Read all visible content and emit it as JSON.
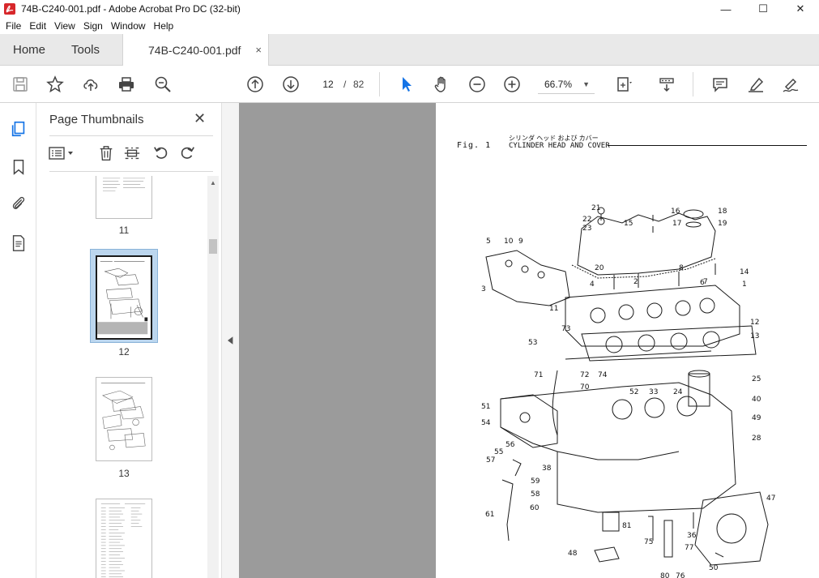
{
  "window": {
    "title": "74B-C240-001.pdf - Adobe Acrobat Pro DC (32-bit)",
    "controls": [
      "—",
      "☐",
      "✕"
    ]
  },
  "menu": [
    "File",
    "Edit",
    "View",
    "Sign",
    "Window",
    "Help"
  ],
  "tabs": {
    "home": "Home",
    "tools": "Tools",
    "document": "74B-C240-001.pdf",
    "close": "×"
  },
  "toolbar": {
    "current_page": "12",
    "separator": "/",
    "total_pages": "82",
    "zoom": "66.7%"
  },
  "thumbnails": {
    "title": "Page Thumbnails",
    "close": "✕",
    "items": [
      {
        "label": "11"
      },
      {
        "label": "12"
      },
      {
        "label": "13"
      }
    ]
  },
  "document": {
    "fig_label": "Fig.  1",
    "title_jp": "シリンダ ヘッド および カバー",
    "title_en": "CYLINDER HEAD AND COVER",
    "part_numbers": [
      "21",
      "22",
      "23",
      "16",
      "17",
      "18",
      "19",
      "15",
      "5",
      "10",
      "9",
      "3",
      "20",
      "8",
      "14",
      "4",
      "2",
      "7",
      "6",
      "1",
      "11",
      "12",
      "13",
      "73",
      "53",
      "71",
      "72",
      "74",
      "70",
      "25",
      "40",
      "51",
      "52",
      "33",
      "24",
      "49",
      "28",
      "54",
      "56",
      "55",
      "57",
      "38",
      "59",
      "58",
      "61",
      "60",
      "81",
      "75",
      "36",
      "77",
      "47",
      "48",
      "80",
      "76",
      "50"
    ]
  },
  "colors": {
    "accent": "#1473e6",
    "tab_bar": "#e9e9e9",
    "doc_bg": "#9b9b9b",
    "selection": "#bcd6ee"
  }
}
